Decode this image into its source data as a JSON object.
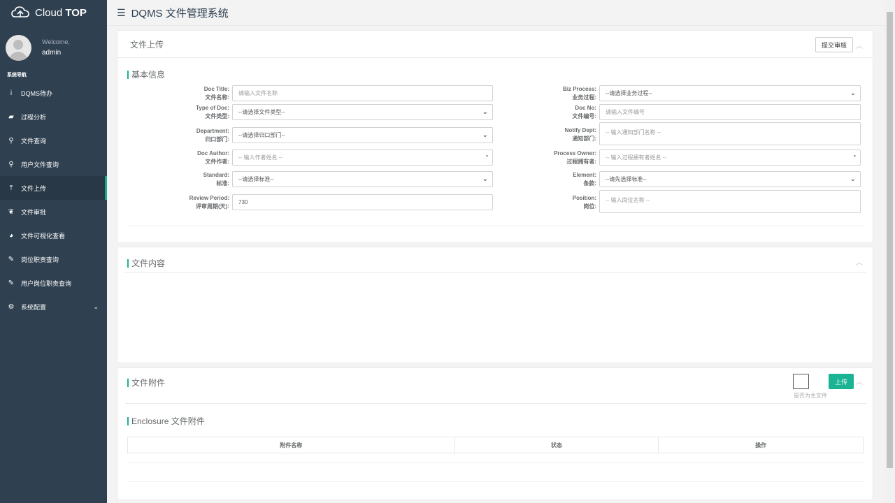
{
  "brand": {
    "name_light": "Cloud ",
    "name_bold": "TOP"
  },
  "profile": {
    "welcome": "Welcome,",
    "user": "admin"
  },
  "sidebar": {
    "section_title": "系统导航",
    "items": [
      {
        "icon": "info-icon",
        "glyph": "i",
        "label": "DQMS待办"
      },
      {
        "icon": "book-icon",
        "glyph": "▰",
        "label": "过程分析"
      },
      {
        "icon": "search-icon",
        "glyph": "⚲",
        "label": "文件查询"
      },
      {
        "icon": "search-icon",
        "glyph": "⚲",
        "label": "用户文件查询"
      },
      {
        "icon": "upload-icon",
        "glyph": "⤒",
        "label": "文件上传"
      },
      {
        "icon": "leaf-icon",
        "glyph": "❦",
        "label": "文件审批"
      },
      {
        "icon": "pie-chart-icon",
        "glyph": "◕",
        "label": "文件可视化查看"
      },
      {
        "icon": "edit-icon",
        "glyph": "✎",
        "label": "岗位职责查询"
      },
      {
        "icon": "edit-icon",
        "glyph": "✎",
        "label": "用户岗位职责查询"
      },
      {
        "icon": "gear-icon",
        "glyph": "⚙",
        "label": "系统配置"
      }
    ],
    "active_index": 4
  },
  "topbar": {
    "title": "DQMS 文件管理系统"
  },
  "upload_panel": {
    "title": "文件上传",
    "submit_label": "提交审核",
    "section": "基本信息",
    "fields": {
      "doc_title": {
        "label_en": "Doc Title:",
        "label_cn": "文件名称:",
        "placeholder": "请输入文件名称"
      },
      "type_of_doc": {
        "label_en": "Type of Doc:",
        "label_cn": "文件类型:",
        "value": "--请选择文件类型--"
      },
      "department": {
        "label_en": "Department:",
        "label_cn": "归口部门:",
        "value": "--请选择归口部门--"
      },
      "doc_author": {
        "label_en": "Doc Author:",
        "label_cn": "文件作者:",
        "placeholder": "-- 输入作者姓名 --"
      },
      "standard": {
        "label_en": "Standard:",
        "label_cn": "标准:",
        "value": "--请选择标准--"
      },
      "review_period": {
        "label_en": "Review Period:",
        "label_cn": "评审周期(天):",
        "value": "730"
      },
      "biz_process": {
        "label_en": "Biz Process:",
        "label_cn": "业务过程:",
        "value": "--请选择业务过程--"
      },
      "doc_no": {
        "label_en": "Doc No:",
        "label_cn": "文件编号:",
        "placeholder": "请输入文件编号"
      },
      "notify_dept": {
        "label_en": "Notify Dept:",
        "label_cn": "通知部门:",
        "placeholder": "-- 输入通知部门名称 --"
      },
      "process_owner": {
        "label_en": "Process Owner:",
        "label_cn": "过程拥有者:",
        "placeholder": "-- 输入过程拥有者姓名 --"
      },
      "element": {
        "label_en": "Element:",
        "label_cn": "条款:",
        "value": "--请先选择标准--"
      },
      "position": {
        "label_en": "Position:",
        "label_cn": "岗位:",
        "placeholder": "-- 输入岗位名称 --"
      }
    }
  },
  "content_panel": {
    "title": "文件内容"
  },
  "attach_panel": {
    "title": "文件附件",
    "upload_label": "上传",
    "main_file_label": "是否为主文件",
    "enclosure_title": "Enclosure 文件附件",
    "columns": [
      "附件名称",
      "状态",
      "操作"
    ]
  },
  "colors": {
    "sidebar": "#2f4050",
    "accent": "#1ab394"
  }
}
